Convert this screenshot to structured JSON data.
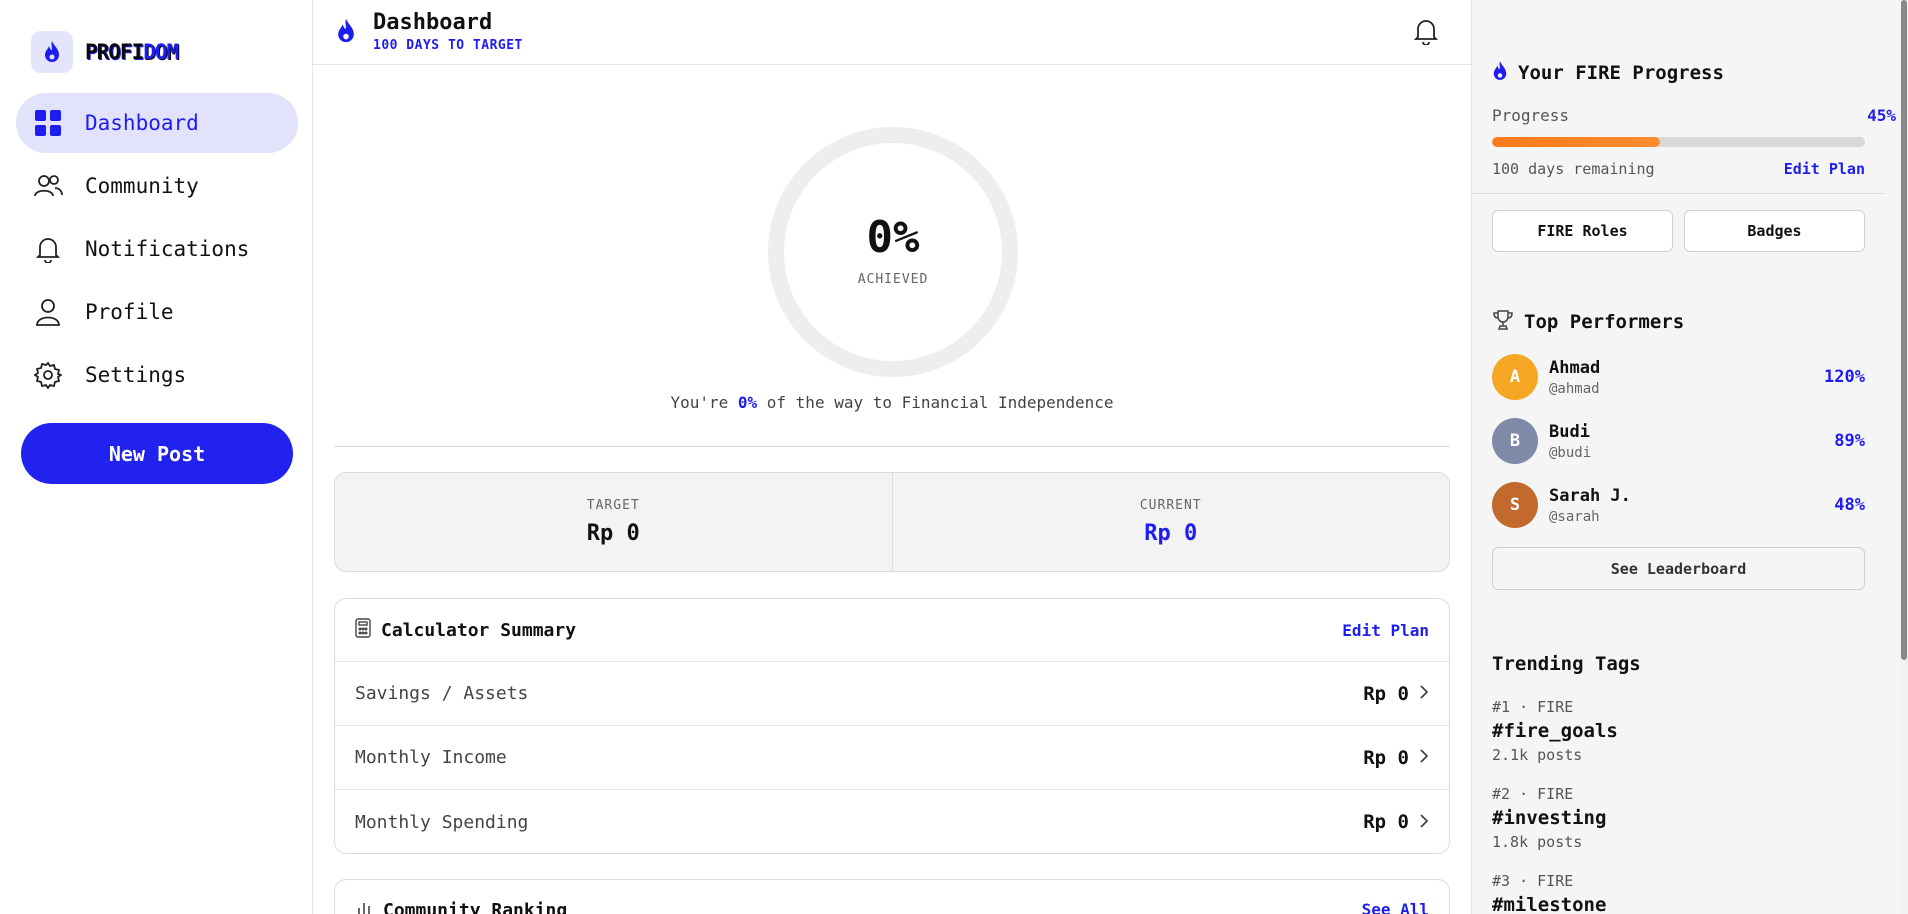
{
  "app": {
    "brand_part1": "PROFI",
    "brand_part2": "DOM"
  },
  "sidebar": {
    "items": [
      {
        "label": "Dashboard",
        "icon": "grid-icon",
        "active": true
      },
      {
        "label": "Community",
        "icon": "users-icon"
      },
      {
        "label": "Notifications",
        "icon": "bell-icon"
      },
      {
        "label": "Profile",
        "icon": "user-icon"
      },
      {
        "label": "Settings",
        "icon": "gear-icon"
      }
    ],
    "new_post_label": "New Post"
  },
  "header": {
    "title": "Dashboard",
    "subtitle": "100 DAYS TO TARGET"
  },
  "progress_ring": {
    "value": "0%",
    "label": "ACHIEVED",
    "fi_prefix": "You're ",
    "fi_pct": "0%",
    "fi_suffix": " of the way to Financial Independence"
  },
  "stats": {
    "target_label": "TARGET",
    "target_value": "Rp 0",
    "current_label": "CURRENT",
    "current_value": "Rp 0"
  },
  "calculator": {
    "title": "Calculator Summary",
    "edit_label": "Edit Plan",
    "rows": [
      {
        "label": "Savings / Assets",
        "value": "Rp 0"
      },
      {
        "label": "Monthly Income",
        "value": "Rp 0"
      },
      {
        "label": "Monthly Spending",
        "value": "Rp 0"
      }
    ]
  },
  "ranking": {
    "title": "Community Ranking",
    "see_all_label": "See All"
  },
  "fire_progress": {
    "title": "Your FIRE Progress",
    "progress_label": "Progress",
    "progress_pct": "45%",
    "progress_fraction": 0.45,
    "remaining": "100 days remaining",
    "edit_label": "Edit Plan",
    "fire_roles_label": "FIRE Roles",
    "badges_label": "Badges"
  },
  "top_performers": {
    "title": "Top Performers",
    "items": [
      {
        "initial": "A",
        "name": "Ahmad",
        "handle": "@ahmad",
        "score": "120%",
        "color": "#f5a623"
      },
      {
        "initial": "B",
        "name": "Budi",
        "handle": "@budi",
        "score": "89%",
        "color": "#7e8aa8"
      },
      {
        "initial": "S",
        "name": "Sarah J.",
        "handle": "@sarah",
        "score": "48%",
        "color": "#c2692e"
      }
    ],
    "leaderboard_label": "See Leaderboard"
  },
  "trending": {
    "title": "Trending Tags",
    "items": [
      {
        "meta": "#1 · FIRE",
        "tag": "#fire_goals",
        "posts": "2.1k posts"
      },
      {
        "meta": "#2 · FIRE",
        "tag": "#investing",
        "posts": "1.8k posts"
      },
      {
        "meta": "#3 · FIRE",
        "tag": "#milestone",
        "posts": ""
      }
    ]
  },
  "colors": {
    "accent": "#1d1df0",
    "progress_fill": "#ff7a1a",
    "active_nav_bg": "#e2e3fb"
  }
}
